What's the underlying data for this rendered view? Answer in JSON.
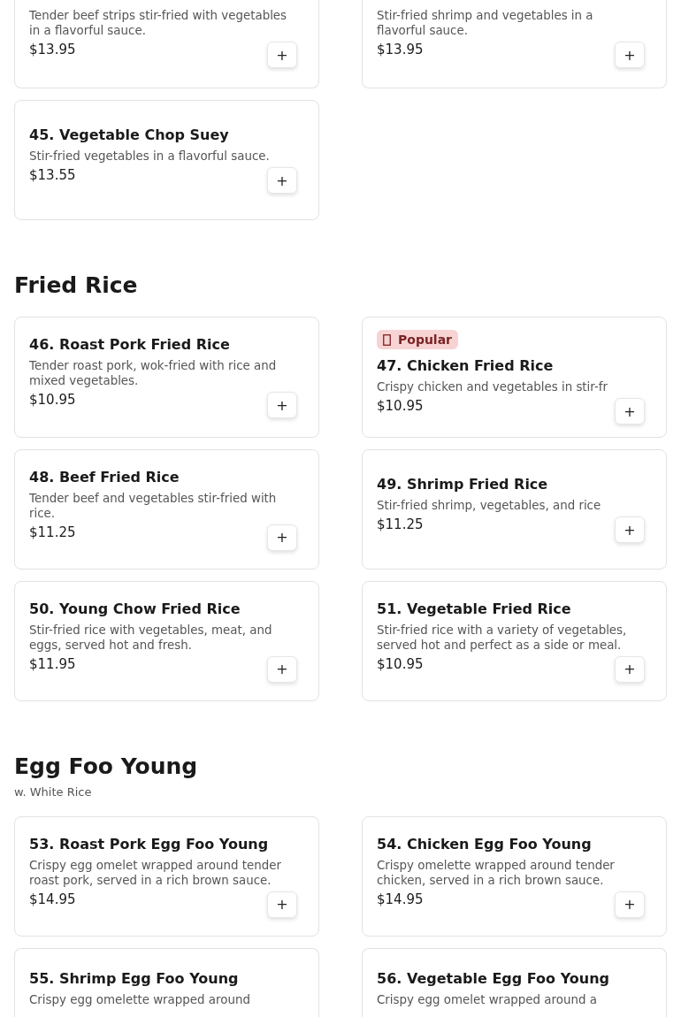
{
  "sections": [
    {
      "items": [
        {
          "kind": "cut_top",
          "description": "Tender beef strips stir-fried with vegetables in a flavorful sauce.",
          "price": "$13.95",
          "add": "+"
        },
        {
          "kind": "cut_top",
          "description": "Stir-fried shrimp and vegetables in a flavorful sauce.",
          "price": "$13.95",
          "add": "+"
        },
        {
          "kind": "full",
          "title": "45. Vegetable Chop Suey",
          "description": "Stir-fried vegetables in a flavorful sauce.",
          "price": "$13.55",
          "add": "+"
        }
      ]
    },
    {
      "title": "Fried Rice",
      "items": [
        {
          "kind": "full",
          "title": "46. Roast Pork Fried Rice",
          "description": "Tender roast pork, wok-fried with rice and mixed vegetables.",
          "price": "$10.95",
          "add": "+"
        },
        {
          "kind": "full",
          "badge": "Popular",
          "title": "47. Chicken Fried Rice",
          "description": "Crispy chicken and vegetables in stir-fr",
          "price": "$10.95",
          "add": "+"
        },
        {
          "kind": "full",
          "title": "48. Beef Fried Rice",
          "description": "Tender beef and vegetables stir-fried with rice.",
          "price": "$11.25",
          "add": "+"
        },
        {
          "kind": "full",
          "title": "49. Shrimp Fried Rice",
          "description": "Stir-fried shrimp, vegetables, and rice",
          "price": "$11.25",
          "add": "+"
        },
        {
          "kind": "full",
          "title": "50. Young Chow Fried Rice",
          "description": "Stir-fried rice with vegetables, meat, and eggs, served hot and fresh.",
          "price": "$11.95",
          "add": "+"
        },
        {
          "kind": "full",
          "title": "51. Vegetable Fried Rice",
          "description": "Stir-fried rice with a variety of vegetables, served hot and perfect as a side or meal.",
          "price": "$10.95",
          "add": "+"
        }
      ]
    },
    {
      "title": "Egg Foo Young",
      "subtitle": "w. White Rice",
      "items": [
        {
          "kind": "full",
          "title": "53. Roast Pork Egg Foo Young",
          "description": "Crispy egg omelet wrapped around tender roast pork, served in a rich brown sauce.",
          "price": "$14.95",
          "add": "+"
        },
        {
          "kind": "full",
          "title": "54. Chicken Egg Foo Young",
          "description": "Crispy omelette wrapped around tender chicken, served in a rich brown sauce.",
          "price": "$14.95",
          "add": "+"
        },
        {
          "kind": "cut_bottom",
          "title": "55. Shrimp Egg Foo Young",
          "description": "Crispy egg omelette wrapped around"
        },
        {
          "kind": "cut_bottom",
          "title": "56. Vegetable Egg Foo Young",
          "description": "Crispy egg omelet wrapped around a"
        }
      ]
    }
  ]
}
